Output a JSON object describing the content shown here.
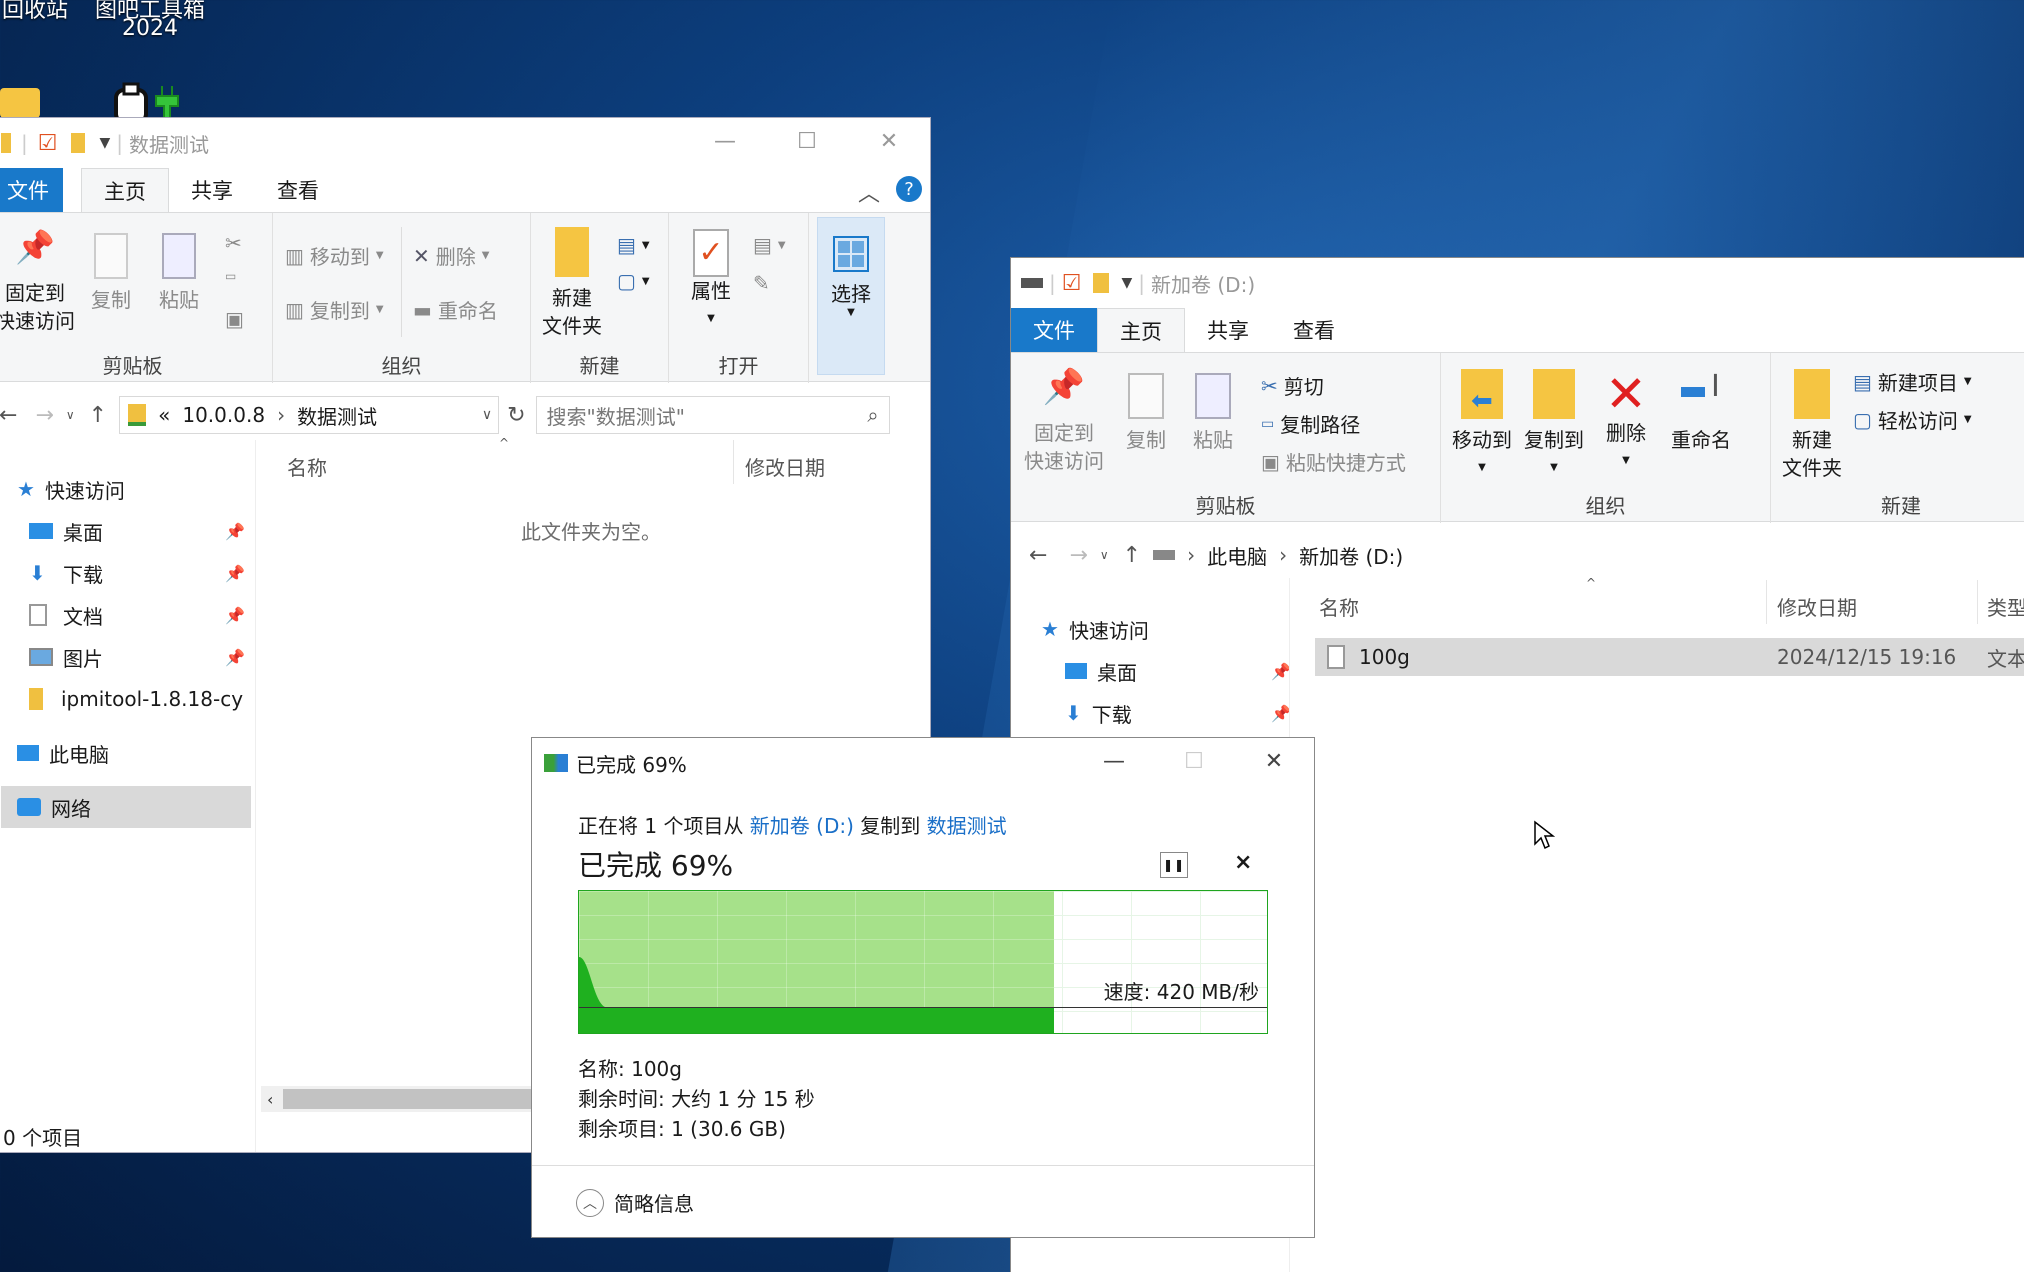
{
  "desktop": {
    "icon1_label": "回收站",
    "icon2_label": "图吧工具箱",
    "icon2_sub": "2024"
  },
  "win1": {
    "title": "数据测试",
    "tabs": [
      "文件",
      "主页",
      "共享",
      "查看"
    ],
    "ribbon": {
      "pin": "固定到",
      "pin2": "快速访问",
      "copy": "复制",
      "paste": "粘贴",
      "group_clipboard": "剪贴板",
      "moveto": "移动到",
      "copyto": "复制到",
      "delete": "删除",
      "rename": "重命名",
      "group_organize": "组织",
      "newfolder": "新建",
      "newfolder2": "文件夹",
      "group_new": "新建",
      "props": "属性",
      "group_open": "打开",
      "select": "选择"
    },
    "address": {
      "prefix": "«",
      "part1": "10.0.0.8",
      "part2": "数据测试"
    },
    "search_placeholder": "搜索\"数据测试\"",
    "nav": {
      "quick": "快速访问",
      "items": [
        "桌面",
        "下载",
        "文档",
        "图片",
        "ipmitool-1.8.18-cy"
      ],
      "pc": "此电脑",
      "net": "网络"
    },
    "col_name": "名称",
    "col_date": "修改日期",
    "empty": "此文件夹为空。",
    "status": "0 个项目"
  },
  "win2": {
    "title": "新加卷 (D:)",
    "tabs": [
      "文件",
      "主页",
      "共享",
      "查看"
    ],
    "ribbon": {
      "pin": "固定到",
      "pin2": "快速访问",
      "copy": "复制",
      "paste": "粘贴",
      "cut": "剪切",
      "copypath": "复制路径",
      "pasteshortcut": "粘贴快捷方式",
      "group_clipboard": "剪贴板",
      "moveto": "移动到",
      "copyto": "复制到",
      "delete": "删除",
      "rename": "重命名",
      "group_organize": "组织",
      "newfolder": "新建",
      "newfolder2": "文件夹",
      "newitem": "新建项目",
      "easyaccess": "轻松访问",
      "group_new": "新建"
    },
    "address": {
      "part1": "此电脑",
      "part2": "新加卷 (D:)"
    },
    "nav": {
      "quick": "快速访问",
      "items": [
        "桌面",
        "下载"
      ]
    },
    "col_name": "名称",
    "col_date": "修改日期",
    "col_type": "类型",
    "file": {
      "name": "100g",
      "date": "2024/12/15 19:16",
      "type": "文本"
    }
  },
  "copy": {
    "title": "已完成 69%",
    "desc_prefix": "正在将 1 个项目从 ",
    "src": "新加卷 (D:)",
    "desc_mid": " 复制到 ",
    "dst": "数据测试",
    "percent_label": "已完成 69%",
    "progress": 0.69,
    "speed": "速度: 420 MB/秒",
    "name": "名称: 100g",
    "time": "剩余时间: 大约 1 分 15 秒",
    "items": "剩余项目: 1 (30.6 GB)",
    "less": "简略信息"
  }
}
